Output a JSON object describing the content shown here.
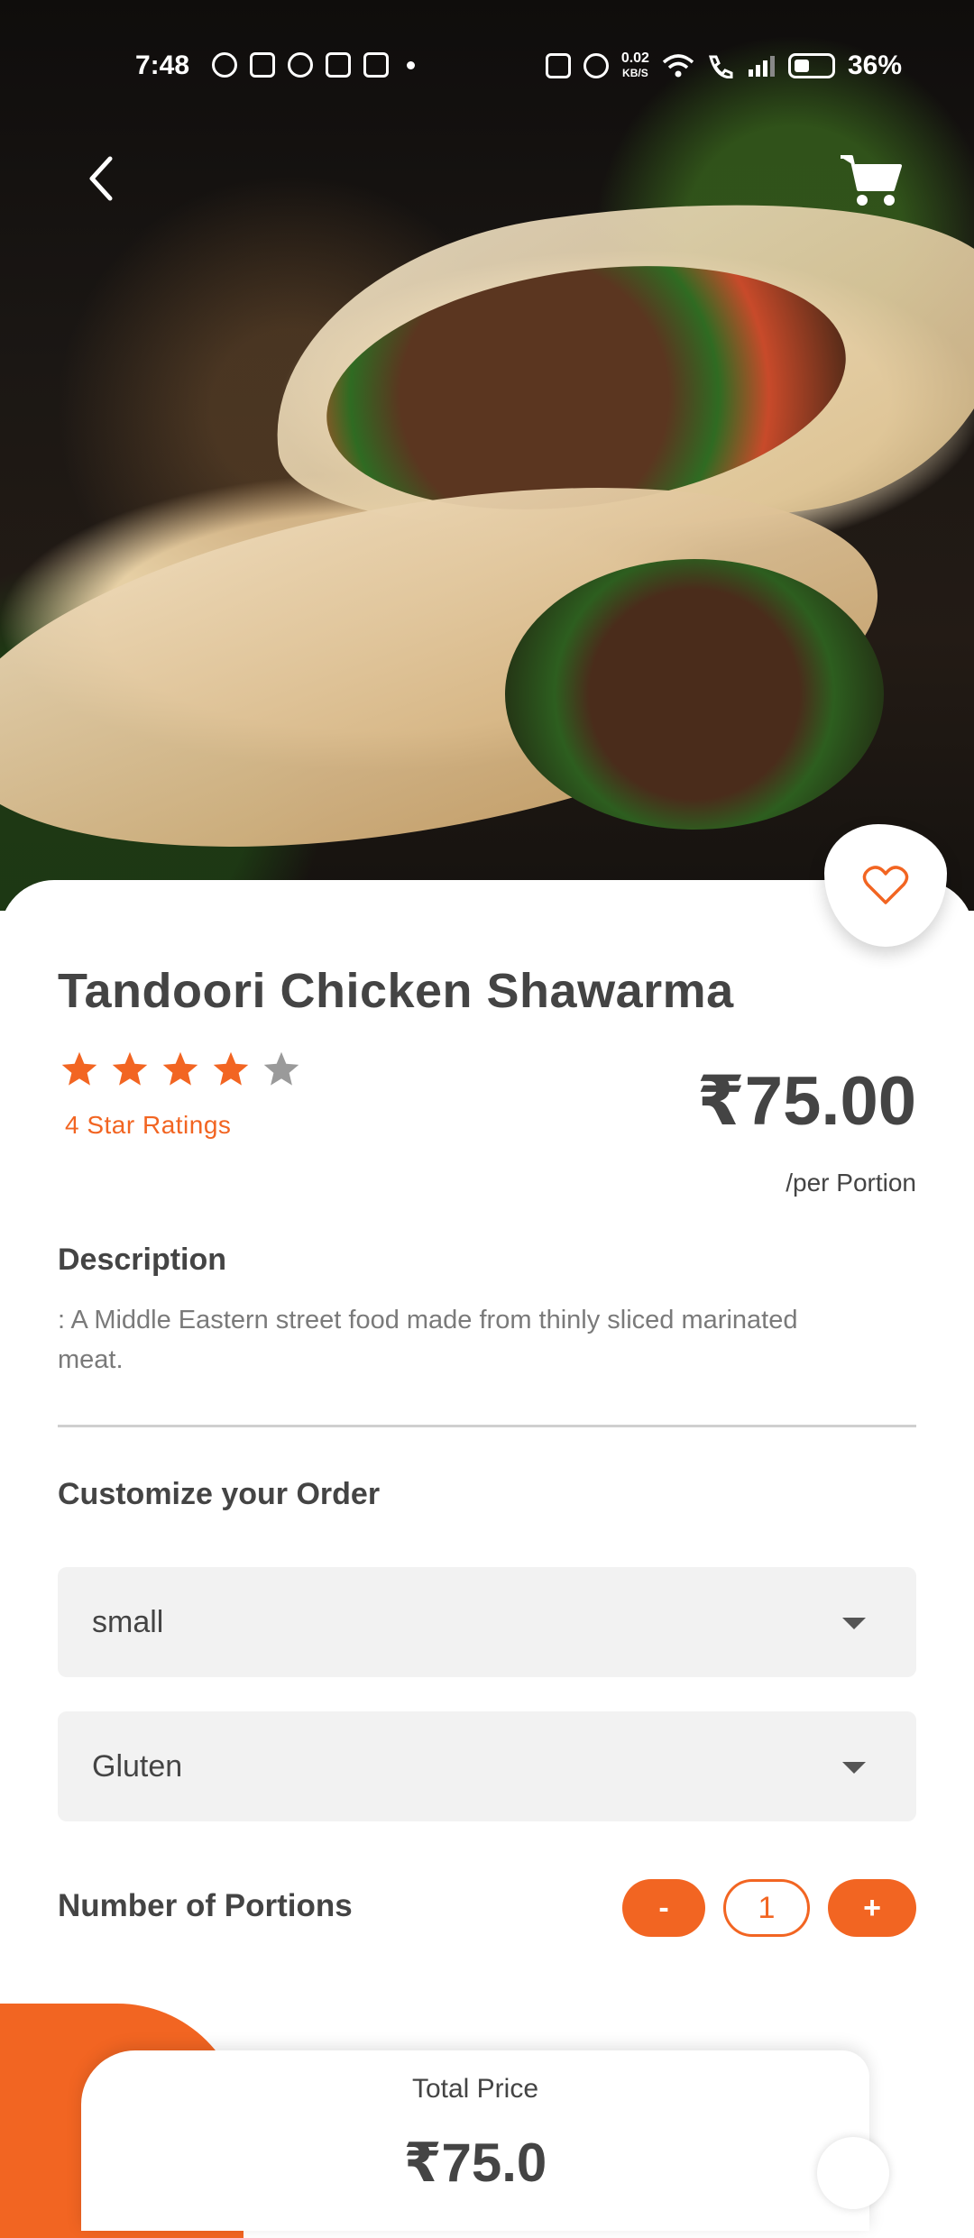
{
  "status_bar": {
    "time": "7:48",
    "network_speed": "0.02",
    "network_speed_unit": "KB/S",
    "battery": "36%"
  },
  "nav": {
    "back_icon": "chevron-left-icon",
    "cart_icon": "shopping-cart-icon"
  },
  "product": {
    "title": "Tandoori Chicken Shawarma",
    "rating": 4,
    "rating_max": 5,
    "rating_label": "4 Star Ratings",
    "price": "₹75.00",
    "price_unit": "/per Portion",
    "description_heading": "Description",
    "description": ": A Middle Eastern street food made from thinly sliced marinated meat."
  },
  "customize": {
    "heading": "Customize your Order",
    "size_selected": "small",
    "diet_selected": "Gluten"
  },
  "portions": {
    "label": "Number of Portions",
    "minus": "-",
    "quantity": "1",
    "plus": "+"
  },
  "total": {
    "label": "Total Price",
    "value": "₹75.0"
  },
  "colors": {
    "accent": "#f26522",
    "text": "#444444",
    "muted": "#7a7a7a",
    "input_bg": "#f2f2f2"
  }
}
